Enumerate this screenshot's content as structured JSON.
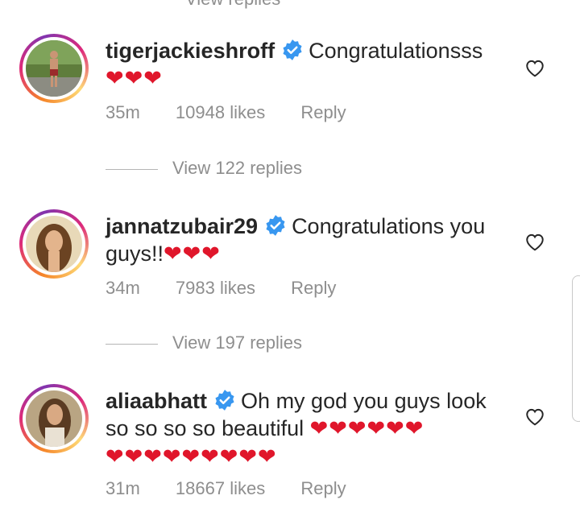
{
  "top_partial": "View replies",
  "comments": [
    {
      "username": "tigerjackieshroff",
      "text": "Congratulationsss",
      "hearts": "❤❤❤",
      "time": "35m",
      "likes": "10948 likes",
      "reply": "Reply",
      "view_replies": "View 122 replies"
    },
    {
      "username": "jannatzubair29",
      "text": "Congratulations you guys!!",
      "hearts": "❤❤❤",
      "time": "34m",
      "likes": "7983 likes",
      "reply": "Reply",
      "view_replies": "View 197 replies"
    },
    {
      "username": "aliaabhatt",
      "text": "Oh my god you guys look so so so so beautiful",
      "hearts": "❤❤❤❤❤❤",
      "hearts2": "❤❤❤❤❤❤❤❤❤",
      "time": "31m",
      "likes": "18667 likes",
      "reply": "Reply"
    }
  ],
  "colors": {
    "text": "#262626",
    "muted": "#8e8e8e",
    "heart": "#e0162b",
    "verified": "#3897f0"
  },
  "icons": [
    "verified-badge-icon",
    "heart-outline-icon"
  ]
}
